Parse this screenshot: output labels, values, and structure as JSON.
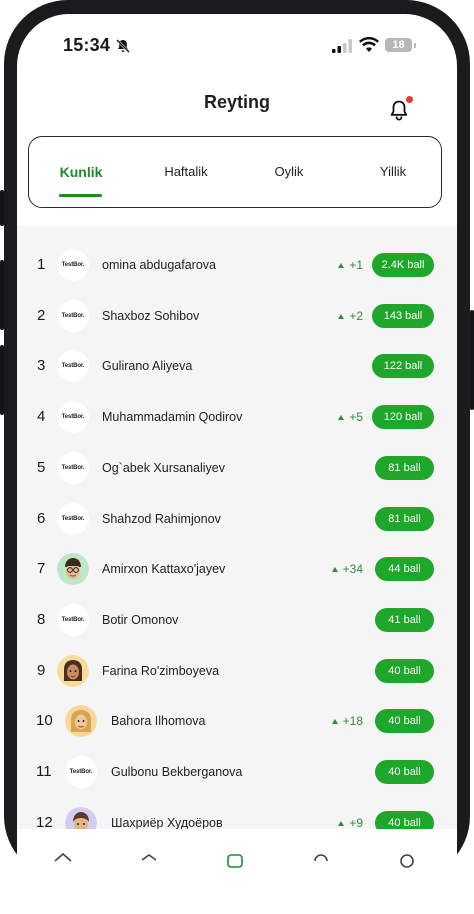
{
  "status_bar": {
    "time": "15:34",
    "battery": "18"
  },
  "header": {
    "title": "Reyting"
  },
  "tabs": [
    {
      "label": "Kunlik",
      "active": true
    },
    {
      "label": "Haftalik",
      "active": false
    },
    {
      "label": "Oylik",
      "active": false
    },
    {
      "label": "Yillik",
      "active": false
    }
  ],
  "ranking": [
    {
      "rank": "1",
      "name": "omina abdugafarova",
      "change": "+1",
      "score": "2.4K ball",
      "avatar": "TestBor."
    },
    {
      "rank": "2",
      "name": "Shaxboz Sohibov",
      "change": "+2",
      "score": "143 ball",
      "avatar": "TestBor."
    },
    {
      "rank": "3",
      "name": "Gulirano Aliyeva",
      "change": "",
      "score": "122 ball",
      "avatar": "TestBor."
    },
    {
      "rank": "4",
      "name": "Muhammadamin Qodirov",
      "change": "+5",
      "score": "120 ball",
      "avatar": "TestBor."
    },
    {
      "rank": "5",
      "name": "Og`abek Xursanaliyev",
      "change": "",
      "score": "81 ball",
      "avatar": "TestBor."
    },
    {
      "rank": "6",
      "name": "Shahzod Rahimjonov",
      "change": "",
      "score": "81 ball",
      "avatar": "TestBor."
    },
    {
      "rank": "7",
      "name": "Amirxon Kattaxo'jayev",
      "change": "+34",
      "score": "44 ball",
      "avatar": "memoji-boy-glasses"
    },
    {
      "rank": "8",
      "name": "Botir Omonov",
      "change": "",
      "score": "41 ball",
      "avatar": "TestBor."
    },
    {
      "rank": "9",
      "name": "Farina Ro'zimboyeva",
      "change": "",
      "score": "40 ball",
      "avatar": "memoji-girl"
    },
    {
      "rank": "10",
      "name": "Bahora Ilhomova",
      "change": "+18",
      "score": "40 ball",
      "avatar": "memoji-girl-blonde"
    },
    {
      "rank": "11",
      "name": "Gulbonu Bekberganova",
      "change": "",
      "score": "40 ball",
      "avatar": "TestBor."
    },
    {
      "rank": "12",
      "name": "Шахриёр Худоёров",
      "change": "+9",
      "score": "40 ball",
      "avatar": "memoji-boy"
    }
  ],
  "colors": {
    "accent": "#1f8a2a",
    "badge": "#1fa72b",
    "list_bg": "#f5f5f5"
  }
}
